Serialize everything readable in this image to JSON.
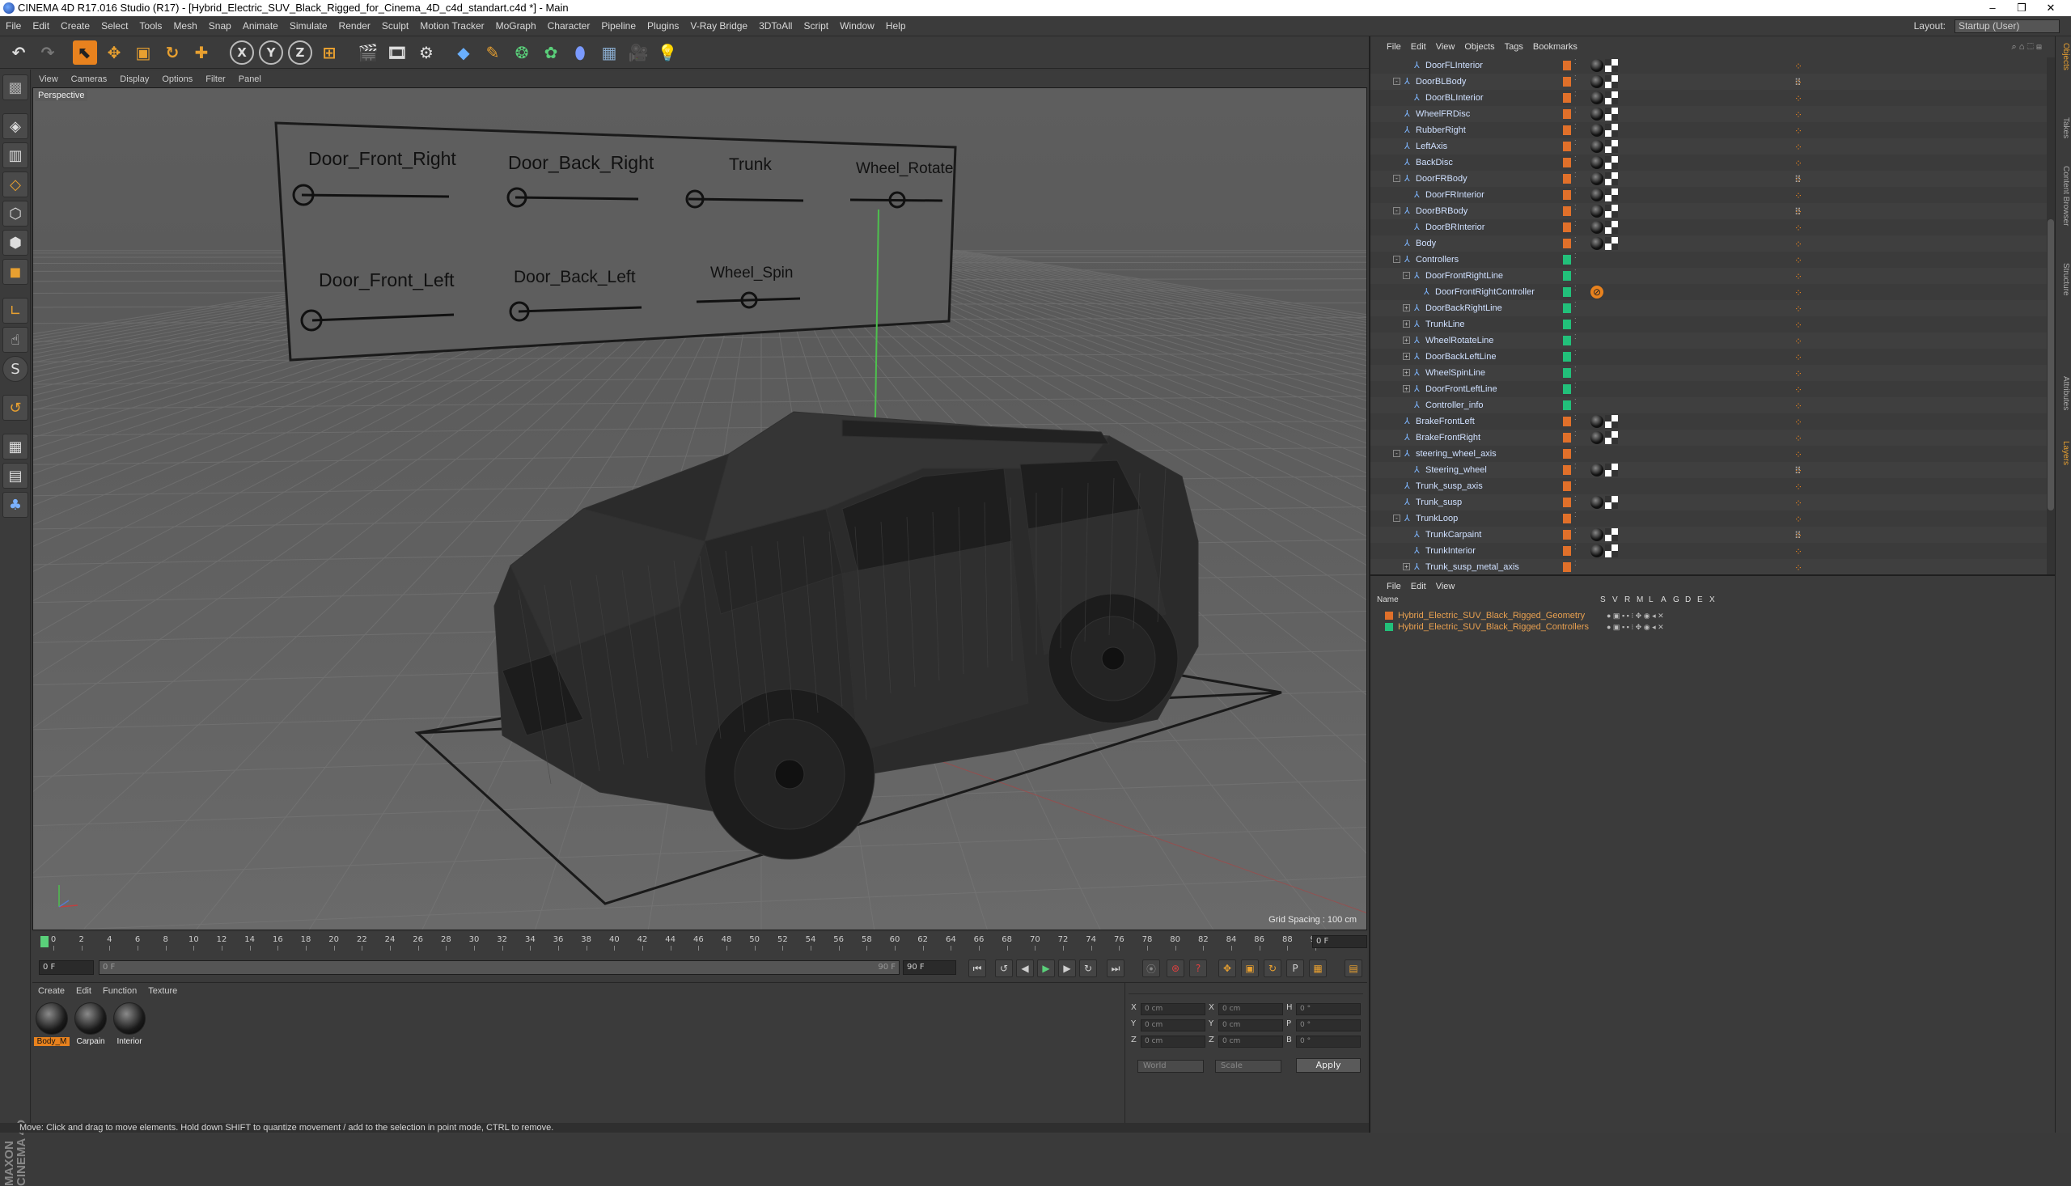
{
  "window": {
    "title": "CINEMA 4D R17.016 Studio (R17) - [Hybrid_Electric_SUV_Black_Rigged_for_Cinema_4D_c4d_standart.c4d *] - Main",
    "minimize": "–",
    "maximize": "❐",
    "close": "✕"
  },
  "menubar": {
    "items": [
      "File",
      "Edit",
      "Create",
      "Select",
      "Tools",
      "Mesh",
      "Snap",
      "Animate",
      "Simulate",
      "Render",
      "Sculpt",
      "Motion Tracker",
      "MoGraph",
      "Character",
      "Pipeline",
      "Plugins",
      "V-Ray Bridge",
      "3DToAll",
      "Script",
      "Window",
      "Help"
    ],
    "layout_label": "Layout:",
    "layout_value": "Startup (User)"
  },
  "toolbar": {
    "axis_x": "X",
    "axis_y": "Y",
    "axis_z": "Z"
  },
  "viewport": {
    "menu": [
      "View",
      "Cameras",
      "Display",
      "Options",
      "Filter",
      "Panel"
    ],
    "label": "Perspective",
    "grid_spacing": "Grid Spacing : 100 cm",
    "controller_labels": {
      "door_front_right": "Door_Front_Right",
      "door_back_right": "Door_Back_Right",
      "trunk": "Trunk",
      "wheel_rotate": "Wheel_Rotate",
      "door_front_left": "Door_Front_Left",
      "door_back_left": "Door_Back_Left",
      "wheel_spin": "Wheel_Spin"
    }
  },
  "timeline": {
    "ticks": [
      "0",
      "2",
      "4",
      "6",
      "8",
      "10",
      "12",
      "14",
      "16",
      "18",
      "20",
      "22",
      "24",
      "26",
      "28",
      "30",
      "32",
      "34",
      "36",
      "38",
      "40",
      "42",
      "44",
      "46",
      "48",
      "50",
      "52",
      "54",
      "56",
      "58",
      "60",
      "62",
      "64",
      "66",
      "68",
      "70",
      "72",
      "74",
      "76",
      "78",
      "80",
      "82",
      "84",
      "86",
      "88",
      "90"
    ],
    "current_frame": "0 F",
    "start_frame": "0 F",
    "range_start": "0 F",
    "range_end": "90 F",
    "end_frame": "90 F"
  },
  "materials": {
    "menu": [
      "Create",
      "Edit",
      "Function",
      "Texture"
    ],
    "items": [
      {
        "label": "Body_M",
        "selected": true
      },
      {
        "label": "Carpain",
        "selected": false
      },
      {
        "label": "Interior",
        "selected": false
      }
    ]
  },
  "coordinates": {
    "rows": [
      {
        "a": "X",
        "av": "0 cm",
        "b": "X",
        "bv": "0 cm",
        "c": "H",
        "cv": "0 °"
      },
      {
        "a": "Y",
        "av": "0 cm",
        "b": "Y",
        "bv": "0 cm",
        "c": "P",
        "cv": "0 °"
      },
      {
        "a": "Z",
        "av": "0 cm",
        "b": "Z",
        "bv": "0 cm",
        "c": "B",
        "cv": "0 °"
      }
    ],
    "mode1": "World",
    "mode2": "Scale",
    "apply": "Apply"
  },
  "status": "Move: Click and drag to move elements. Hold down SHIFT to quantize movement / add to the selection in point mode, CTRL to remove.",
  "object_manager": {
    "menu": [
      "File",
      "Edit",
      "View",
      "Objects",
      "Tags",
      "Bookmarks"
    ],
    "rows": [
      {
        "name": "DoorFLInterior",
        "indent": 2,
        "exp": "",
        "layer": "#e0702a",
        "tags": "mcd"
      },
      {
        "name": "DoorBLBody",
        "indent": 1,
        "exp": "-",
        "layer": "#e0702a",
        "tags": "smcd"
      },
      {
        "name": "DoorBLInterior",
        "indent": 2,
        "exp": "",
        "layer": "#e0702a",
        "tags": "mcd"
      },
      {
        "name": "WheelFRDisc",
        "indent": 1,
        "exp": "",
        "layer": "#e0702a",
        "tags": "mcd"
      },
      {
        "name": "RubberRight",
        "indent": 1,
        "exp": "",
        "layer": "#e0702a",
        "tags": "mcd"
      },
      {
        "name": "LeftAxis",
        "indent": 1,
        "exp": "",
        "layer": "#e0702a",
        "tags": "mcd"
      },
      {
        "name": "BackDisc",
        "indent": 1,
        "exp": "",
        "layer": "#e0702a",
        "tags": "mcd"
      },
      {
        "name": "DoorFRBody",
        "indent": 1,
        "exp": "-",
        "layer": "#e0702a",
        "tags": "smcd"
      },
      {
        "name": "DoorFRInterior",
        "indent": 2,
        "exp": "",
        "layer": "#e0702a",
        "tags": "mcd"
      },
      {
        "name": "DoorBRBody",
        "indent": 1,
        "exp": "-",
        "layer": "#e0702a",
        "tags": "smcd"
      },
      {
        "name": "DoorBRInterior",
        "indent": 2,
        "exp": "",
        "layer": "#e0702a",
        "tags": "mcd"
      },
      {
        "name": "Body",
        "indent": 1,
        "exp": "",
        "layer": "#e0702a",
        "tags": "mcd"
      },
      {
        "name": "Controllers",
        "indent": 1,
        "exp": "-",
        "layer": "#22c07a",
        "tags": "d"
      },
      {
        "name": "DoorFrontRightLine",
        "indent": 2,
        "exp": "-",
        "layer": "#22c07a",
        "tags": "d"
      },
      {
        "name": "DoorFrontRightController",
        "indent": 3,
        "exp": "",
        "layer": "#22c07a",
        "tags": "xd"
      },
      {
        "name": "DoorBackRightLine",
        "indent": 2,
        "exp": "+",
        "layer": "#22c07a",
        "tags": "d"
      },
      {
        "name": "TrunkLine",
        "indent": 2,
        "exp": "+",
        "layer": "#22c07a",
        "tags": "d"
      },
      {
        "name": "WheelRotateLine",
        "indent": 2,
        "exp": "+",
        "layer": "#22c07a",
        "tags": "d"
      },
      {
        "name": "DoorBackLeftLine",
        "indent": 2,
        "exp": "+",
        "layer": "#22c07a",
        "tags": "d"
      },
      {
        "name": "WheelSpinLine",
        "indent": 2,
        "exp": "+",
        "layer": "#22c07a",
        "tags": "d"
      },
      {
        "name": "DoorFrontLeftLine",
        "indent": 2,
        "exp": "+",
        "layer": "#22c07a",
        "tags": "d"
      },
      {
        "name": "Controller_info",
        "indent": 2,
        "exp": "",
        "layer": "#22c07a",
        "tags": "d"
      },
      {
        "name": "BrakeFrontLeft",
        "indent": 1,
        "exp": "",
        "layer": "#e0702a",
        "tags": "mcd"
      },
      {
        "name": "BrakeFrontRight",
        "indent": 1,
        "exp": "",
        "layer": "#e0702a",
        "tags": "mcd"
      },
      {
        "name": "steering_wheel_axis",
        "indent": 1,
        "exp": "-",
        "layer": "#e0702a",
        "tags": "d"
      },
      {
        "name": "Steering_wheel",
        "indent": 2,
        "exp": "",
        "layer": "#e0702a",
        "tags": "smcd"
      },
      {
        "name": "Trunk_susp_axis",
        "indent": 1,
        "exp": "",
        "layer": "#e0702a",
        "tags": "d"
      },
      {
        "name": "Trunk_susp",
        "indent": 1,
        "exp": "",
        "layer": "#e0702a",
        "tags": "mcd"
      },
      {
        "name": "TrunkLoop",
        "indent": 1,
        "exp": "-",
        "layer": "#e0702a",
        "tags": "d"
      },
      {
        "name": "TrunkCarpaint",
        "indent": 2,
        "exp": "",
        "layer": "#e0702a",
        "tags": "smcd"
      },
      {
        "name": "TrunkInterior",
        "indent": 2,
        "exp": "",
        "layer": "#e0702a",
        "tags": "mcd"
      },
      {
        "name": "Trunk_susp_metal_axis",
        "indent": 2,
        "exp": "+",
        "layer": "#e0702a",
        "tags": "d"
      }
    ]
  },
  "layer_manager": {
    "menu": [
      "File",
      "Edit",
      "View"
    ],
    "header_name": "Name",
    "header_cols": [
      "S",
      "V",
      "R",
      "M",
      "L",
      "A",
      "G",
      "D",
      "E",
      "X"
    ],
    "layers": [
      {
        "name": "Hybrid_Electric_SUV_Black_Rigged_Geometry",
        "color": "#e0702a"
      },
      {
        "name": "Hybrid_Electric_SUV_Black_Rigged_Controllers",
        "color": "#22c07a"
      }
    ]
  },
  "side_tabs": [
    "Objects",
    "Takes",
    "Content Browser",
    "Structure",
    "Attributes",
    "Layers"
  ]
}
